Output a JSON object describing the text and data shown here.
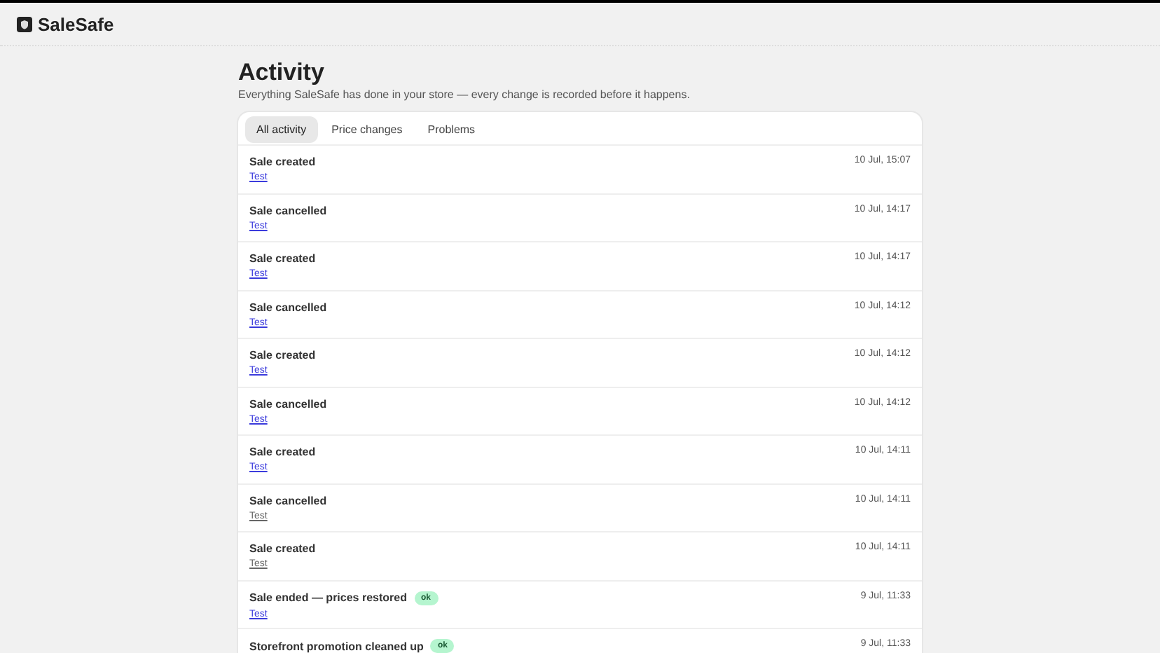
{
  "app": {
    "name": "SaleSafe"
  },
  "page": {
    "title": "Activity",
    "subtitle": "Everything SaleSafe has done in your store — every change is recorded before it happens."
  },
  "tabs": [
    {
      "label": "All activity",
      "selected": true
    },
    {
      "label": "Price changes",
      "selected": false
    },
    {
      "label": "Problems",
      "selected": false
    }
  ],
  "events": [
    {
      "title": "Sale created",
      "link": "Test",
      "visited": false,
      "time": "10 Jul, 15:07"
    },
    {
      "title": "Sale cancelled",
      "link": "Test",
      "visited": false,
      "time": "10 Jul, 14:17"
    },
    {
      "title": "Sale created",
      "link": "Test",
      "visited": false,
      "time": "10 Jul, 14:17"
    },
    {
      "title": "Sale cancelled",
      "link": "Test",
      "visited": false,
      "time": "10 Jul, 14:12"
    },
    {
      "title": "Sale created",
      "link": "Test",
      "visited": false,
      "time": "10 Jul, 14:12"
    },
    {
      "title": "Sale cancelled",
      "link": "Test",
      "visited": false,
      "time": "10 Jul, 14:12"
    },
    {
      "title": "Sale created",
      "link": "Test",
      "visited": false,
      "time": "10 Jul, 14:11"
    },
    {
      "title": "Sale cancelled",
      "link": "Test",
      "visited": true,
      "time": "10 Jul, 14:11"
    },
    {
      "title": "Sale created",
      "link": "Test",
      "visited": true,
      "time": "10 Jul, 14:11"
    },
    {
      "title": "Sale ended — prices restored",
      "badge": "ok",
      "link": "Test",
      "visited": false,
      "time": "9 Jul, 11:33"
    },
    {
      "title": "Storefront promotion cleaned up",
      "badge": "ok",
      "time": "9 Jul, 11:33"
    }
  ]
}
